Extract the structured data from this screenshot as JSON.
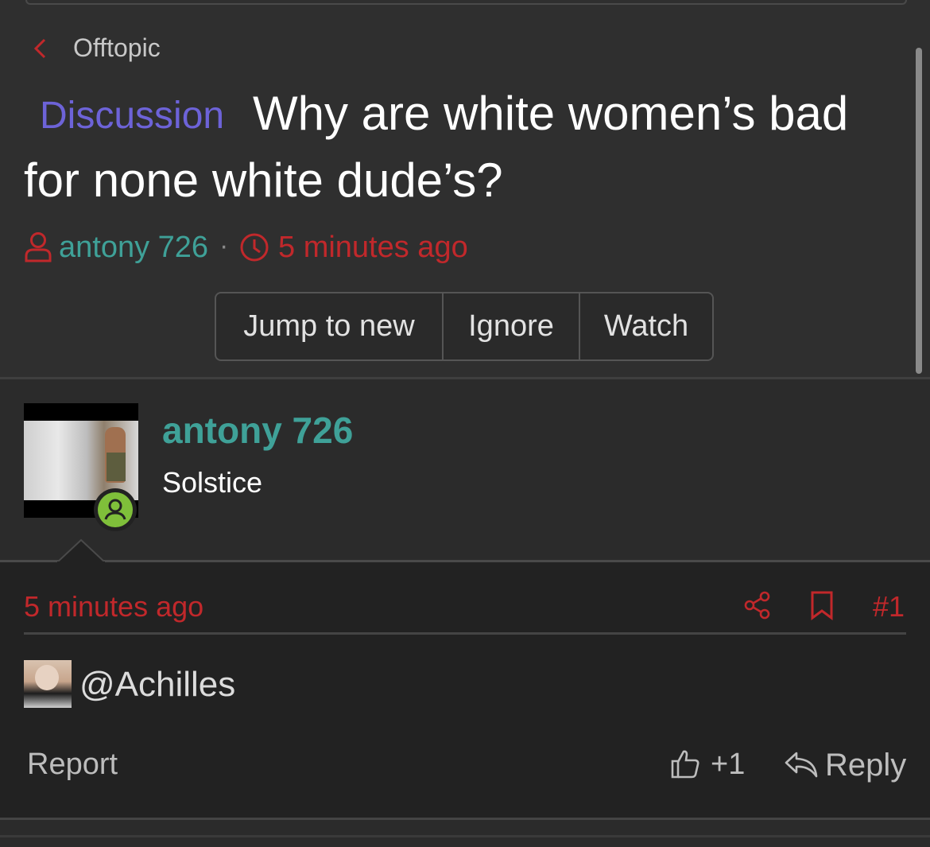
{
  "breadcrumb": {
    "label": "Offtopic"
  },
  "thread": {
    "prefix": "Discussion",
    "title_line1": "Why are white women’s bad",
    "title_line2": "for none white dude’s?",
    "author": "antony 726",
    "separator": "·",
    "time": "5 minutes ago"
  },
  "actions": {
    "jump": "Jump to new",
    "ignore": "Ignore",
    "watch": "Watch"
  },
  "post": {
    "author": "antony 726",
    "user_title": "Solstice",
    "time": "5 minutes ago",
    "number": "#1",
    "mention": "@Achilles",
    "report": "Report",
    "reactions": "+1",
    "reply": "Reply"
  },
  "colors": {
    "accent_red": "#c1282b",
    "username_teal": "#3fa198",
    "prefix_purple": "#6d63d8",
    "online_green": "#7fbf3a"
  },
  "icons": [
    "chevron-left-icon",
    "user-icon",
    "clock-icon",
    "online-status-icon",
    "share-icon",
    "bookmark-icon",
    "thumbs-up-icon",
    "reply-icon"
  ]
}
